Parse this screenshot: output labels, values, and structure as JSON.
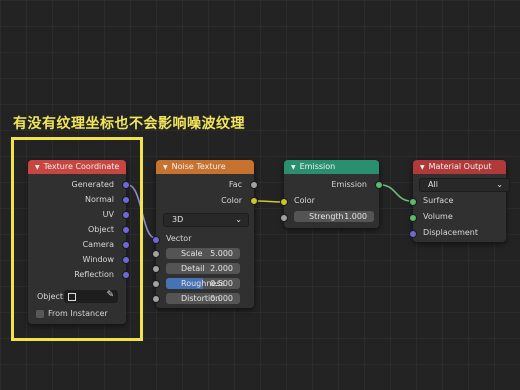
{
  "caption": "有没有纹理坐标也不会影响噪波纹理",
  "colors": {
    "highlight": "#f2e34b",
    "texture_header": "#c84641",
    "noise_header": "#c7722f",
    "emission_header": "#2a8f6e",
    "output_header": "#b03a3a",
    "socket_vector": "#6f67d9",
    "socket_float": "#a1a1a1",
    "socket_color": "#c7c729",
    "socket_shader": "#5cba6c"
  },
  "texture_coordinate": {
    "title": "Texture Coordinate",
    "outputs": [
      "Generated",
      "Normal",
      "UV",
      "Object",
      "Camera",
      "Window",
      "Reflection"
    ],
    "object_label": "Object:",
    "from_instancer_label": "From Instancer",
    "from_instancer_checked": false
  },
  "noise_texture": {
    "title": "Noise Texture",
    "outputs": [
      "Fac",
      "Color"
    ],
    "dimensions": "3D",
    "vector_label": "Vector",
    "fields": [
      {
        "label": "Scale",
        "value": "5.000"
      },
      {
        "label": "Detail",
        "value": "2.000"
      },
      {
        "label": "Roughness",
        "value": "0.500",
        "fill": 0.5
      },
      {
        "label": "Distortion",
        "value": "0.000"
      }
    ]
  },
  "emission": {
    "title": "Emission",
    "output": "Emission",
    "color_label": "Color",
    "strength_label": "Strength",
    "strength_value": "1.000"
  },
  "material_output": {
    "title": "Material Output",
    "target": "All",
    "inputs": [
      "Surface",
      "Volume",
      "Displacement"
    ]
  }
}
